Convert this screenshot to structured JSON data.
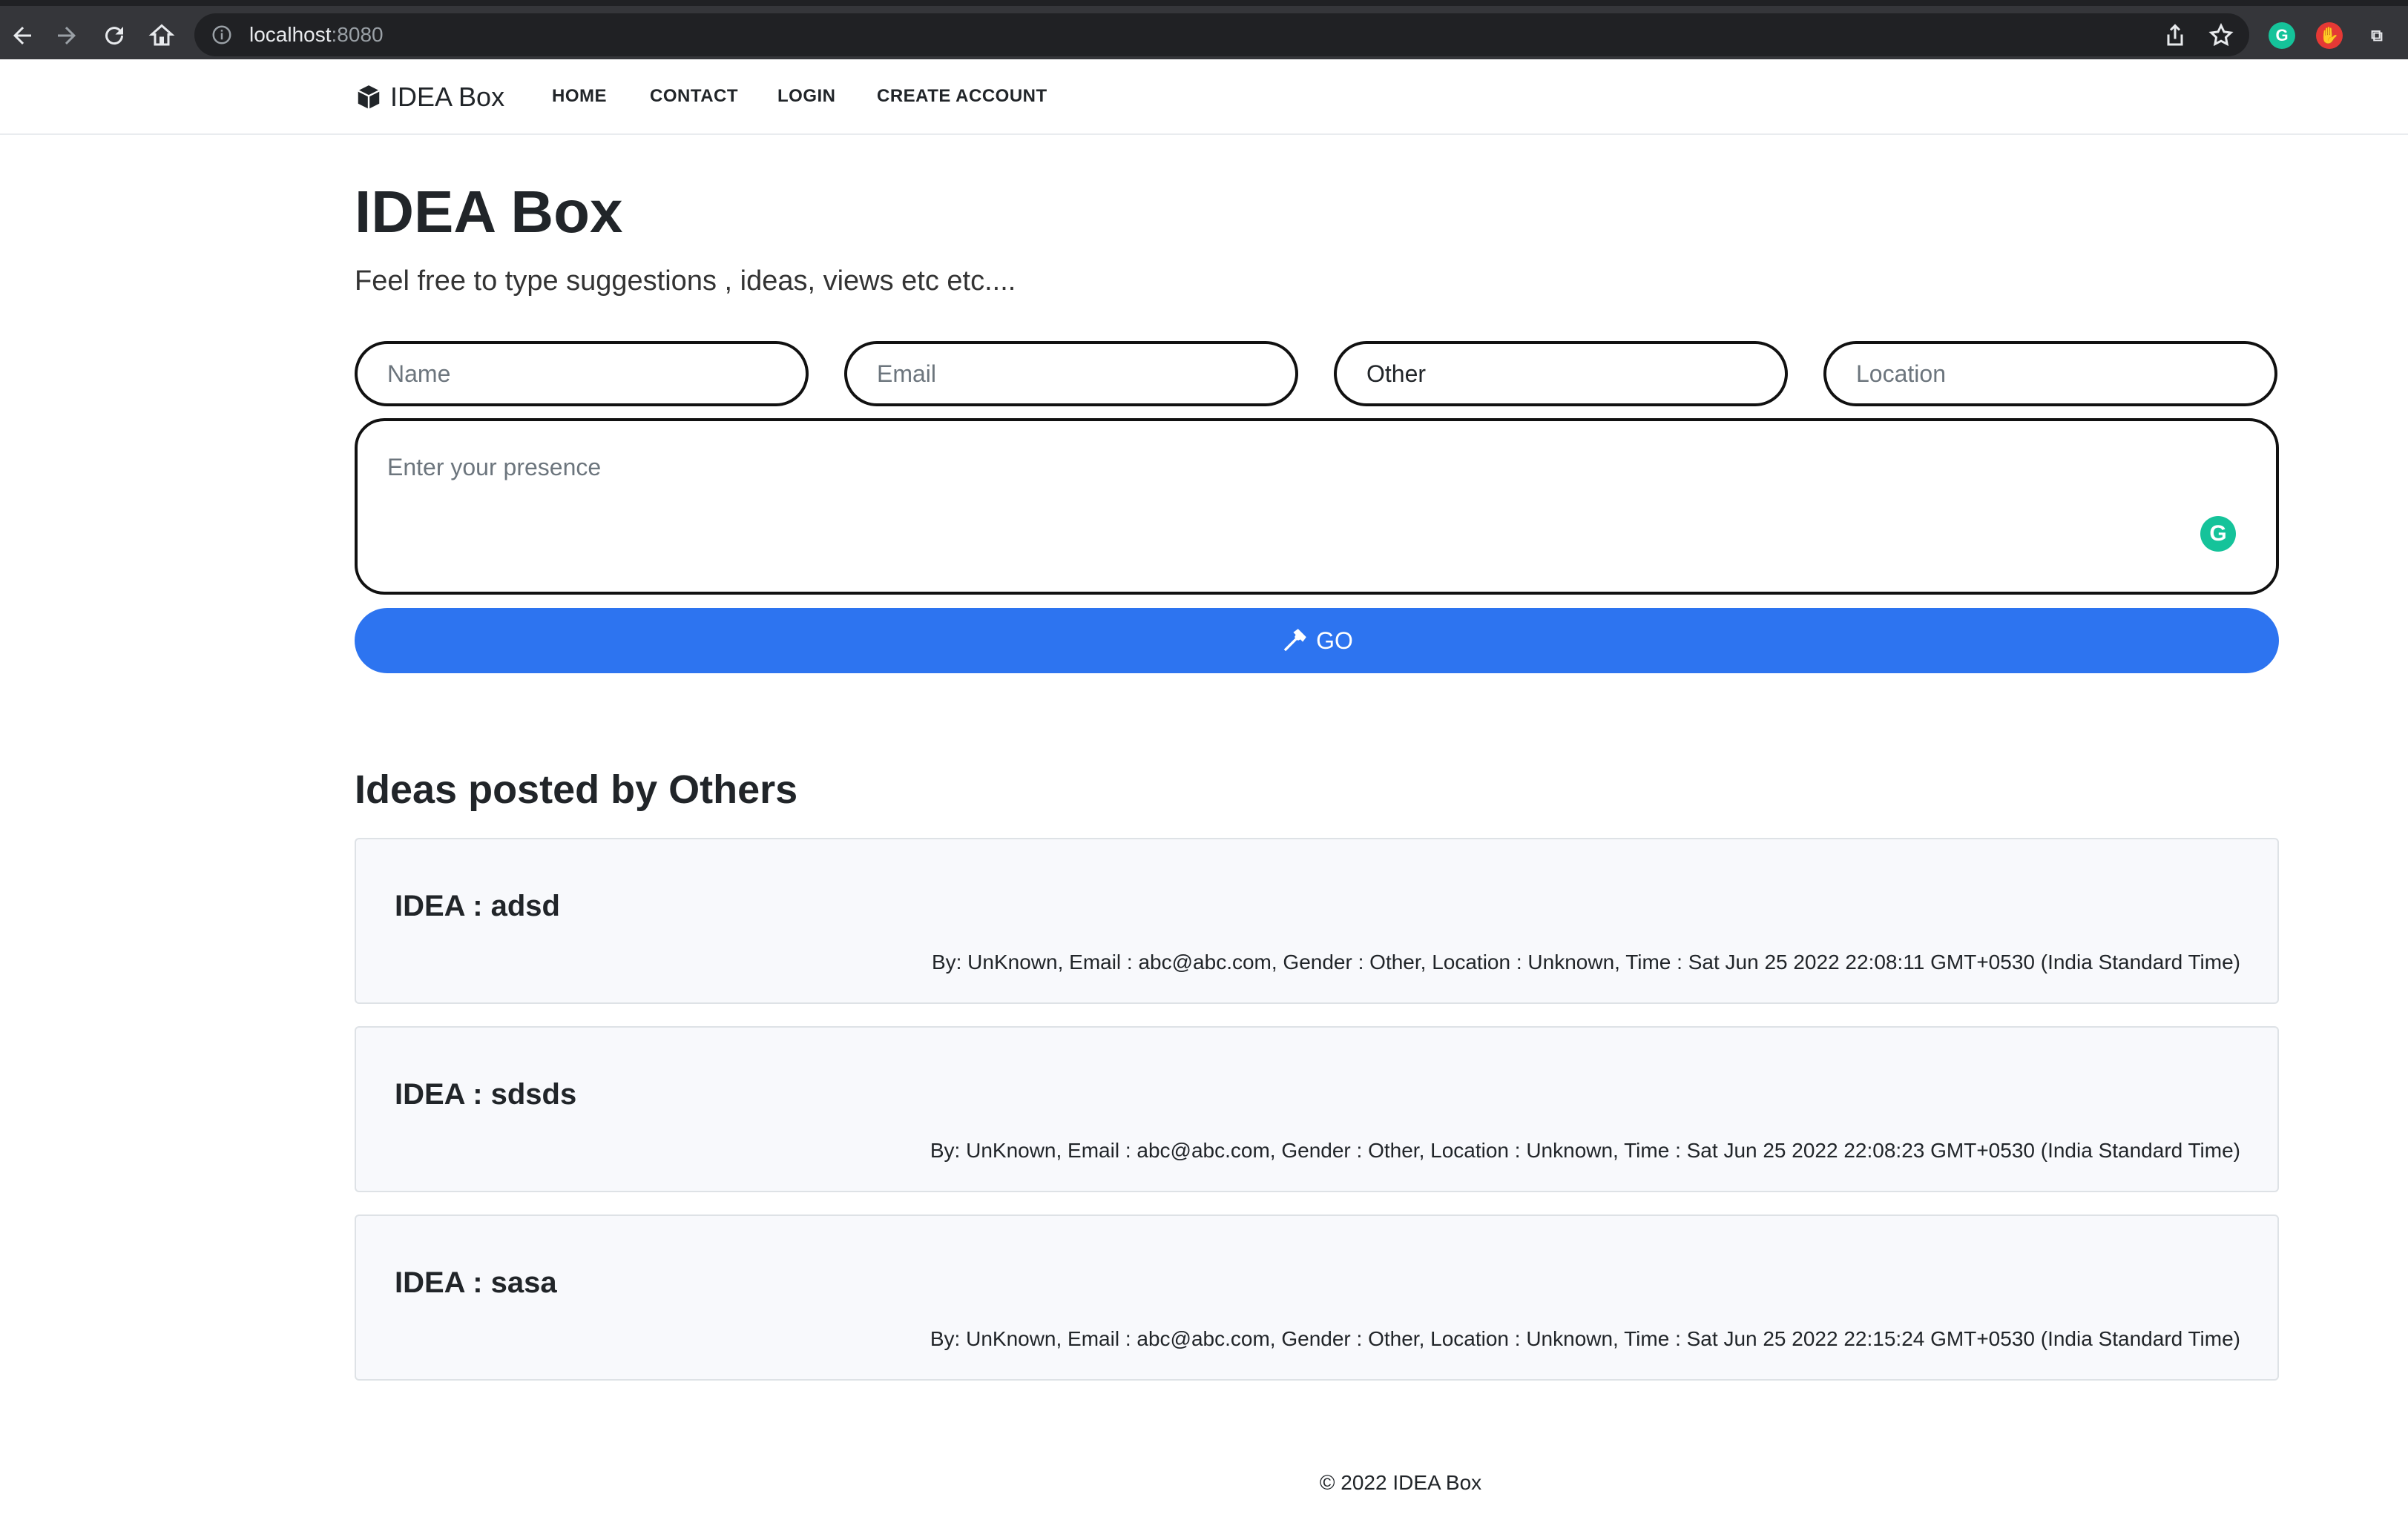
{
  "browser": {
    "url_host": "localhost",
    "url_port": ":8080",
    "icons": [
      "back-arrow-icon",
      "forward-arrow-icon",
      "reload-icon",
      "home-icon",
      "info-icon",
      "share-icon",
      "star-icon"
    ],
    "extensions": [
      {
        "name": "grammarly",
        "glyph": "G",
        "color": "#15c39a"
      },
      {
        "name": "red-extension",
        "glyph": "✋",
        "color": "#e53935"
      },
      {
        "name": "puzzle",
        "glyph": "⧉",
        "color": "#5f6368"
      }
    ]
  },
  "nav": {
    "brand": "IDEA Box",
    "links": [
      "HOME",
      "CONTACT",
      "LOGIN",
      "CREATE ACCOUNT"
    ]
  },
  "hero": {
    "title": "IDEA Box",
    "subtitle": "Feel free to type suggestions , ideas, views etc etc...."
  },
  "form": {
    "name_placeholder": "Name",
    "email_placeholder": "Email",
    "gender_value": "Other",
    "location_placeholder": "Location",
    "presence_placeholder": "Enter your presence",
    "go_label": "GO"
  },
  "ideas_section": {
    "title": "Ideas posted by Others",
    "items": [
      {
        "title": "IDEA : adsd",
        "meta": "By: UnKnown, Email : abc@abc.com, Gender : Other, Location : Unknown, Time : Sat Jun 25 2022 22:08:11 GMT+0530 (India Standard Time)"
      },
      {
        "title": "IDEA : sdsds",
        "meta": "By: UnKnown, Email : abc@abc.com, Gender : Other, Location : Unknown, Time : Sat Jun 25 2022 22:08:23 GMT+0530 (India Standard Time)"
      },
      {
        "title": "IDEA : sasa",
        "meta": "By: UnKnown, Email : abc@abc.com, Gender : Other, Location : Unknown, Time : Sat Jun 25 2022 22:15:24 GMT+0530 (India Standard Time)"
      }
    ]
  },
  "footer": {
    "text": "© 2022 IDEA Box"
  },
  "colors": {
    "primary_button": "#2d74f0",
    "card_background": "#f8f9fc"
  }
}
